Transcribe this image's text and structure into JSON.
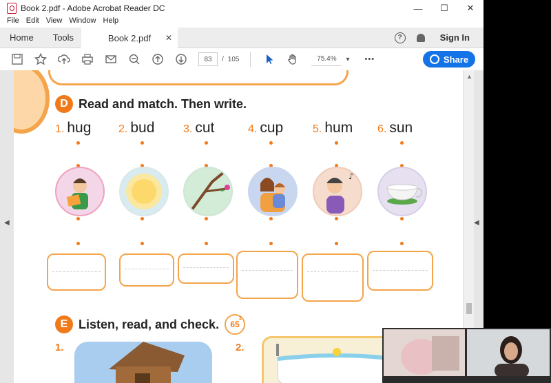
{
  "window": {
    "title": "Book 2.pdf - Adobe Acrobat Reader DC",
    "min": "—",
    "max": "☐",
    "close": "✕"
  },
  "menu": [
    "File",
    "Edit",
    "View",
    "Window",
    "Help"
  ],
  "tabs": {
    "home": "Home",
    "tools": "Tools",
    "doc": "Book 2.pdf",
    "doc_close": "✕",
    "signin": "Sign In",
    "help": "?"
  },
  "toolbar": {
    "page_current": "83",
    "page_sep": "/",
    "page_total": "105",
    "zoom": "75.4%",
    "zoom_arrow": "▾",
    "more": "•••",
    "share": "Share"
  },
  "sectionD": {
    "badge": "D",
    "heading": "Read and match. Then write.",
    "words": [
      {
        "num": "1.",
        "text": "hug"
      },
      {
        "num": "2.",
        "text": "bud"
      },
      {
        "num": "3.",
        "text": "cut"
      },
      {
        "num": "4.",
        "text": "cup"
      },
      {
        "num": "5.",
        "text": "hum"
      },
      {
        "num": "6.",
        "text": "sun"
      }
    ]
  },
  "sectionE": {
    "badge": "E",
    "heading": "Listen, read, and check.",
    "track": "65",
    "track_sup": "2",
    "item1": "1.",
    "item2": "2."
  },
  "colors": {
    "accent": "#f07a1a",
    "share": "#1473e6"
  }
}
